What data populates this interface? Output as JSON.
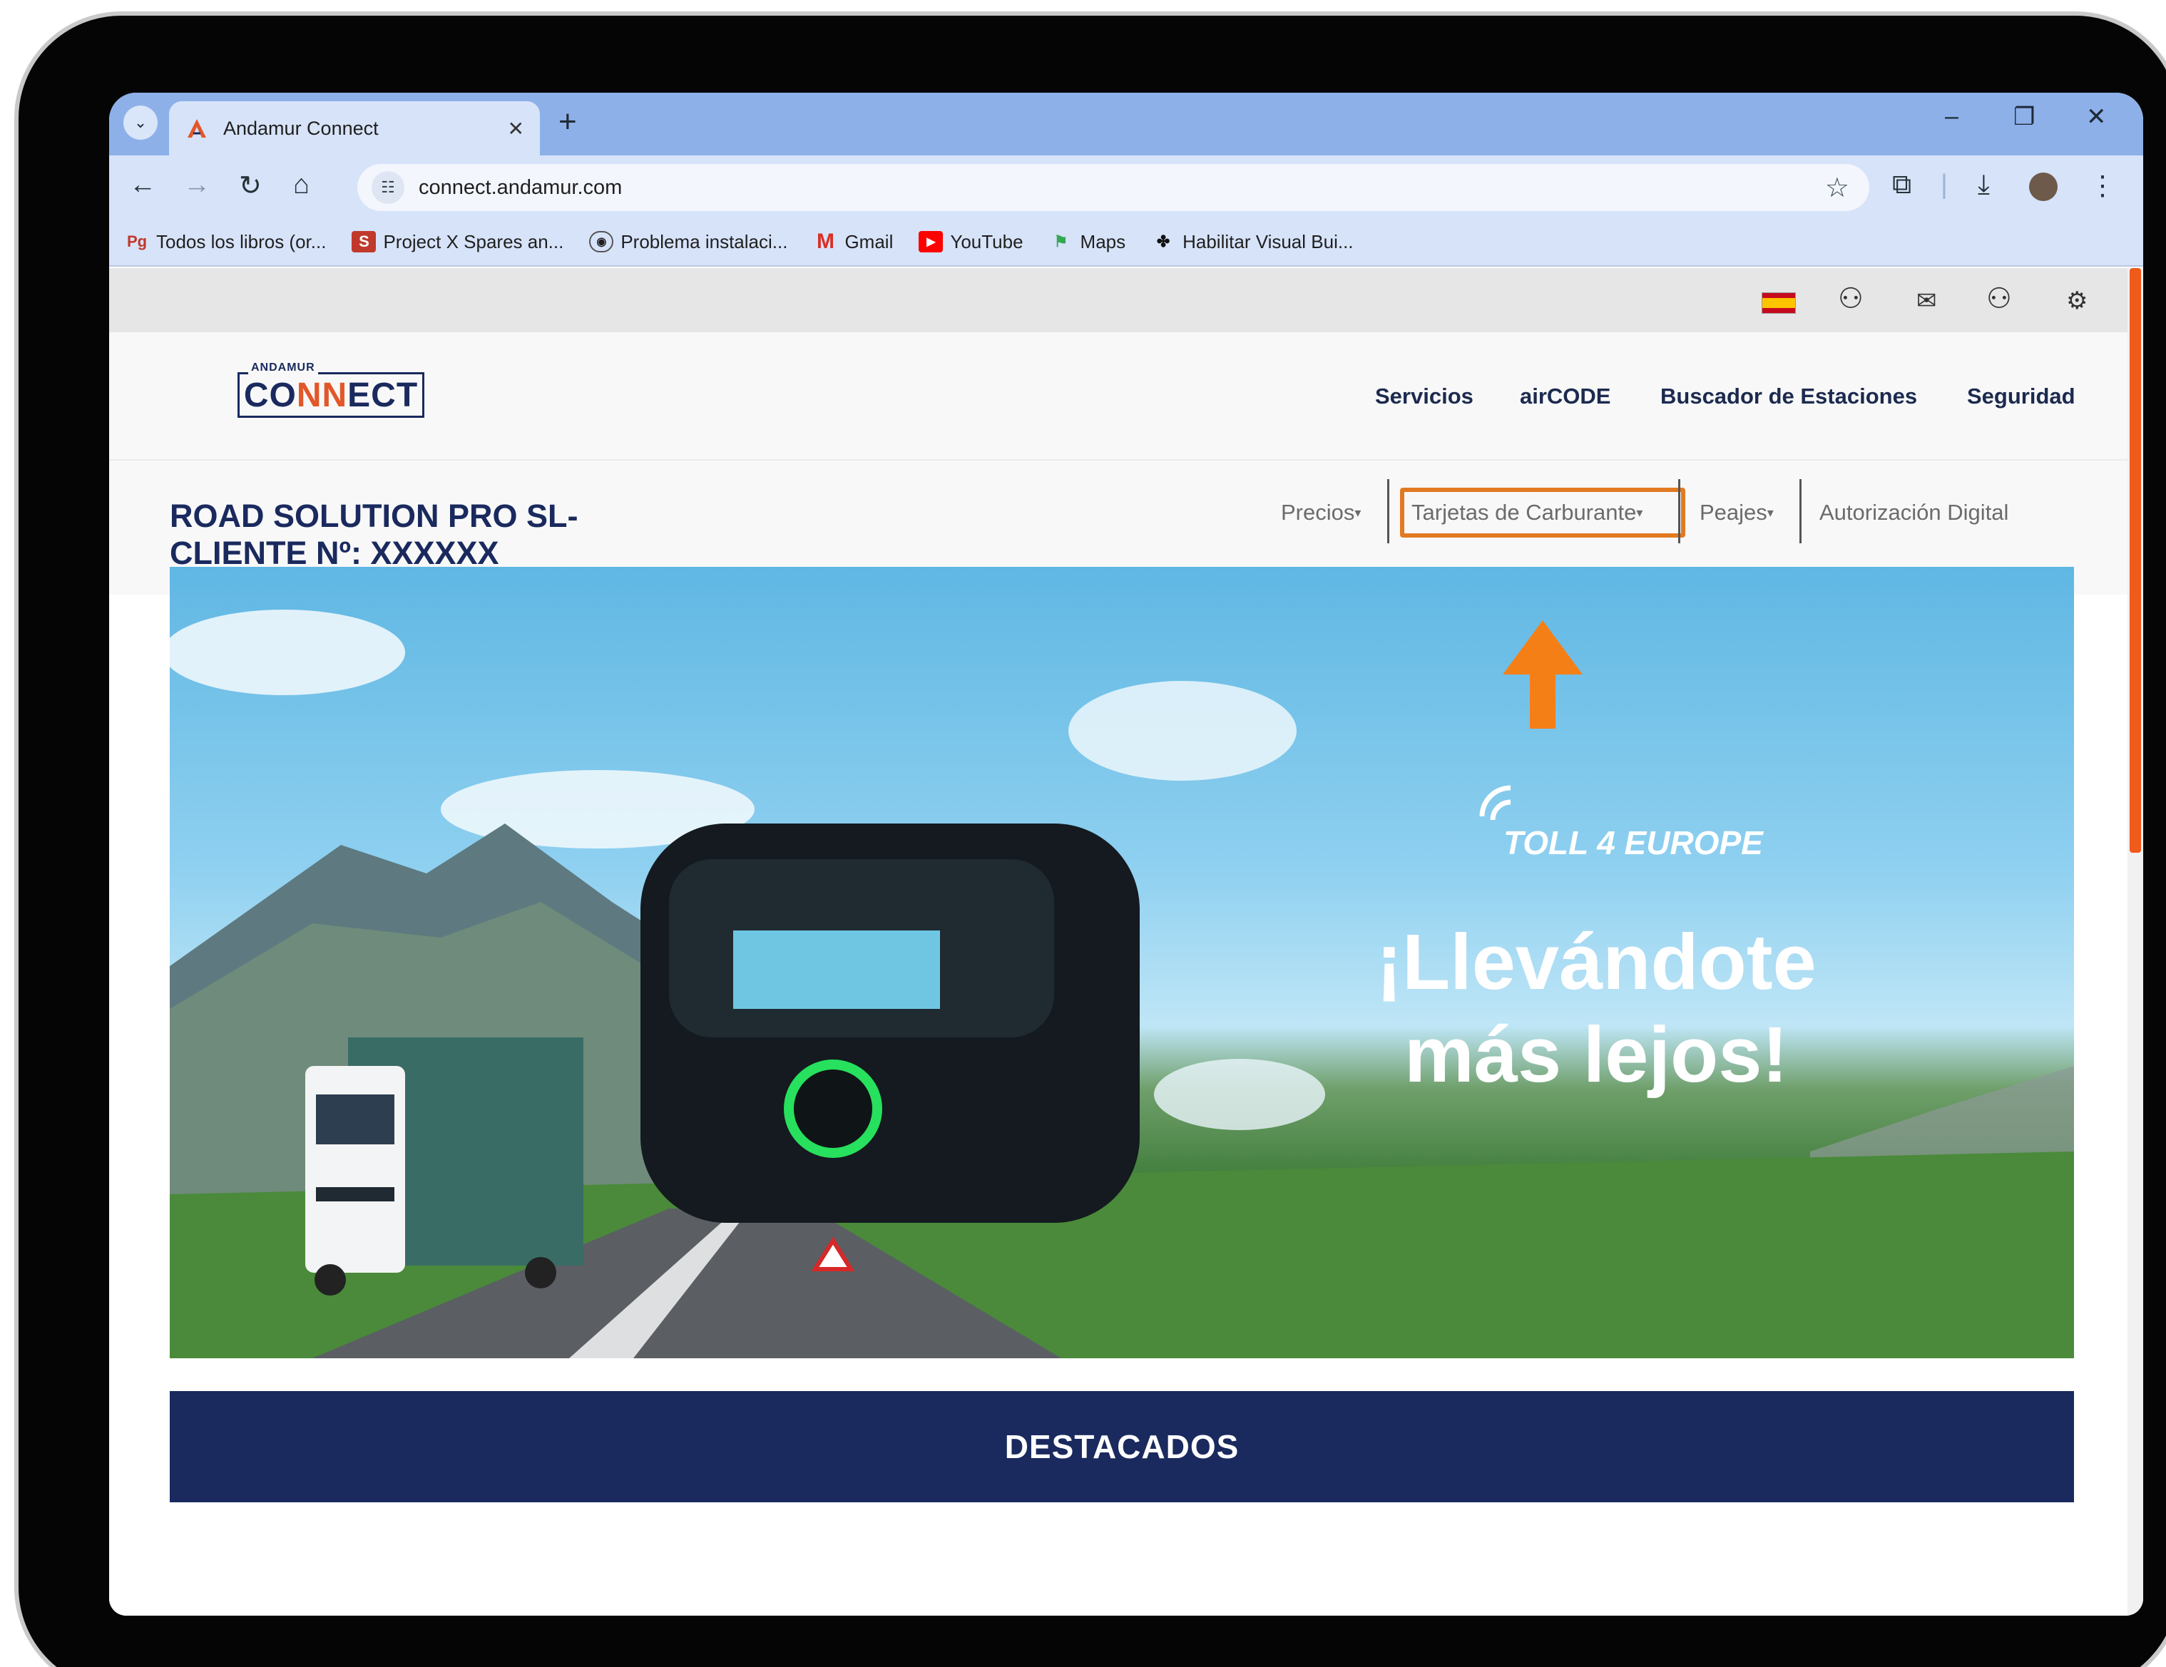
{
  "browser": {
    "tab_title": "Andamur Connect",
    "url": "connect.andamur.com",
    "bookmarks": [
      {
        "label": "Todos los libros (or...",
        "icon": "pg-icon"
      },
      {
        "label": "Project X Spares an...",
        "icon": "s-icon"
      },
      {
        "label": "Problema instalaci...",
        "icon": "page-icon"
      },
      {
        "label": "Gmail",
        "icon": "gmail-icon"
      },
      {
        "label": "YouTube",
        "icon": "youtube-icon"
      },
      {
        "label": "Maps",
        "icon": "maps-icon"
      },
      {
        "label": "Habilitar Visual Bui...",
        "icon": "puzzle-icon"
      }
    ]
  },
  "site": {
    "logo_top": "ANDAMUR",
    "logo_main_a": "CO",
    "logo_main_b": "NN",
    "logo_main_c": "ECT",
    "nav": [
      "Servicios",
      "airCODE",
      "Buscador de Estaciones",
      "Seguridad"
    ],
    "client_line1": "ROAD SOLUTION PRO SL-",
    "client_line2": "CLIENTE Nº: XXXXXX",
    "subnav": [
      "Precios",
      "Tarjetas de Carburante",
      "Peajes",
      "Autorización Digital"
    ],
    "banner_brand": "TOLL 4 EUROPE",
    "banner_line1": "¡Llevándote",
    "banner_line2": "más lejos!",
    "section_title": "DESTACADOS"
  },
  "colors": {
    "brand_navy": "#1a2a5e",
    "highlight": "#e27a22",
    "scroll_accent": "#f05a1a"
  }
}
